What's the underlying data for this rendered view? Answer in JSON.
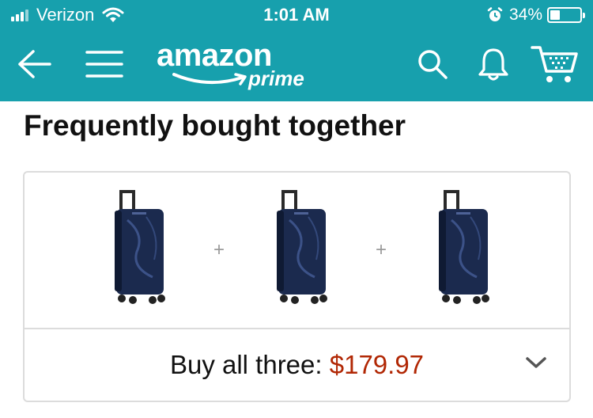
{
  "status_bar": {
    "carrier": "Verizon",
    "time": "1:01 AM",
    "battery_percent": "34%",
    "battery_level": 0.34
  },
  "nav": {
    "logo_word": "amazon",
    "logo_prime": "prime",
    "icons": [
      "back-arrow-icon",
      "hamburger-menu-icon",
      "search-icon",
      "bell-icon",
      "cart-icon"
    ]
  },
  "section": {
    "title": "Frequently bought together"
  },
  "bundle": {
    "products": [
      {
        "image": "navy-hardside-spinner-suitcase"
      },
      {
        "image": "navy-hardside-spinner-suitcase"
      },
      {
        "image": "navy-hardside-spinner-suitcase"
      }
    ],
    "plus_sign": "+",
    "buy_label": "Buy all three:",
    "buy_price": "$179.97"
  },
  "colors": {
    "header_bg": "#17a0ad",
    "price": "#b12704",
    "suitcase": "#1b2a4e"
  }
}
